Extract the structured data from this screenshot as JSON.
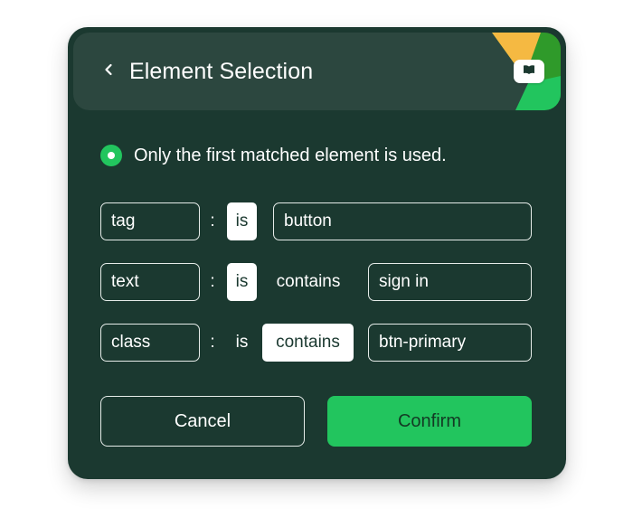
{
  "header": {
    "title": "Element Selection",
    "back_icon": "chevron-left-icon",
    "book_icon": "book-open-icon",
    "corner_colors": [
      "#f5b942",
      "#2f9a2a",
      "#22c55e"
    ]
  },
  "notice": {
    "text": "Only the first matched element is used.",
    "selected": true
  },
  "rules": [
    {
      "attribute": "tag",
      "separator": ":",
      "operators": [
        {
          "label": "is",
          "selected": true
        }
      ],
      "value": "button"
    },
    {
      "attribute": "text",
      "separator": ":",
      "operators": [
        {
          "label": "is",
          "selected": true
        },
        {
          "label": "contains",
          "selected": false
        }
      ],
      "value": "sign in"
    },
    {
      "attribute": "class",
      "separator": ":",
      "operators": [
        {
          "label": "is",
          "selected": false
        },
        {
          "label": "contains",
          "selected": true
        }
      ],
      "value": "btn-primary"
    }
  ],
  "actions": {
    "cancel_label": "Cancel",
    "confirm_label": "Confirm"
  },
  "colors": {
    "card_bg": "#1b3930",
    "header_bg": "#2c473f",
    "accent": "#22c55e",
    "text": "#ffffff"
  }
}
